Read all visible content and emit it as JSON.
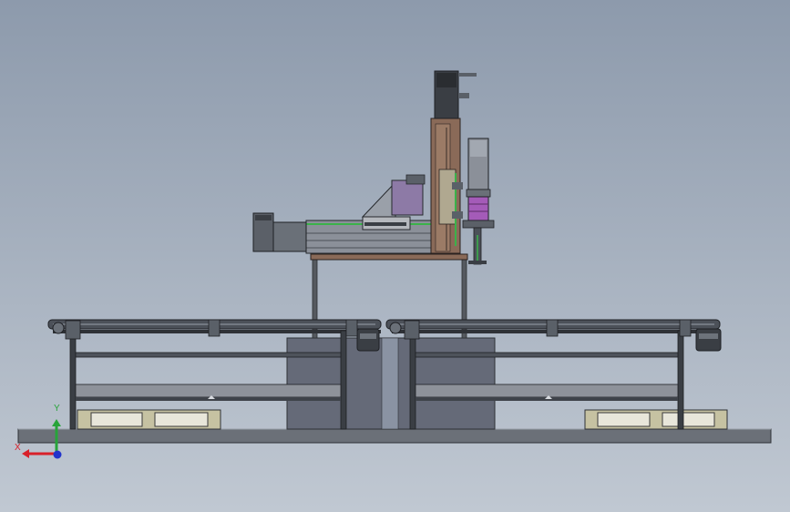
{
  "viewport": {
    "background_top": "#8d9aac",
    "background_bottom": "#c0c8d2"
  },
  "model": {
    "frame_color": "#4b5058",
    "conveyor_color": "#3a3e44",
    "pallet_color": "#c6c2a2",
    "motor_color": "#5b6068",
    "coupling_color": "#a45bb8",
    "plate_color": "#8a6a58",
    "rail_accent_color": "#3bb24a"
  },
  "triad": {
    "x_label": "X",
    "y_label": "Y",
    "x_color": "#d8202a",
    "y_color": "#27a43a",
    "z_color": "#2233cc"
  }
}
